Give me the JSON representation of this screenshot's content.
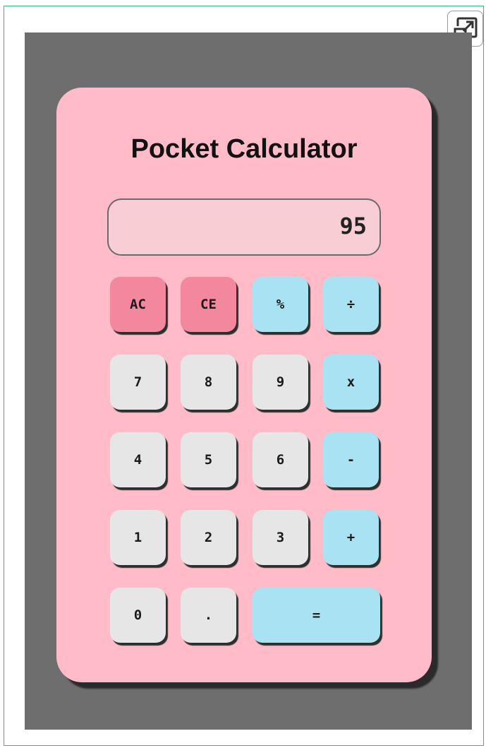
{
  "calculator": {
    "title": "Pocket Calculator",
    "display_value": "95",
    "rows": [
      [
        {
          "label": "AC",
          "kind": "red",
          "name": "all-clear-button"
        },
        {
          "label": "CE",
          "kind": "red",
          "name": "clear-entry-button"
        },
        {
          "label": "%",
          "kind": "blue",
          "name": "percent-button"
        },
        {
          "label": "÷",
          "kind": "blue",
          "name": "divide-button"
        }
      ],
      [
        {
          "label": "7",
          "kind": "gray",
          "name": "digit-7-button"
        },
        {
          "label": "8",
          "kind": "gray",
          "name": "digit-8-button"
        },
        {
          "label": "9",
          "kind": "gray",
          "name": "digit-9-button"
        },
        {
          "label": "x",
          "kind": "blue",
          "name": "multiply-button"
        }
      ],
      [
        {
          "label": "4",
          "kind": "gray",
          "name": "digit-4-button"
        },
        {
          "label": "5",
          "kind": "gray",
          "name": "digit-5-button"
        },
        {
          "label": "6",
          "kind": "gray",
          "name": "digit-6-button"
        },
        {
          "label": "-",
          "kind": "blue",
          "name": "subtract-button"
        }
      ],
      [
        {
          "label": "1",
          "kind": "gray",
          "name": "digit-1-button"
        },
        {
          "label": "2",
          "kind": "gray",
          "name": "digit-2-button"
        },
        {
          "label": "3",
          "kind": "gray",
          "name": "digit-3-button"
        },
        {
          "label": "+",
          "kind": "blue",
          "name": "add-button"
        }
      ],
      [
        {
          "label": "0",
          "kind": "gray",
          "name": "digit-0-button"
        },
        {
          "label": ".",
          "kind": "gray",
          "name": "decimal-point-button"
        },
        {
          "label": "=",
          "kind": "blue",
          "name": "equals-button"
        }
      ]
    ]
  },
  "toolbar": {
    "expand_icon": "expand-icon"
  },
  "colors": {
    "frame_border": "#2ebd78",
    "stage_background": "#6e6e6e",
    "calculator_body": "#ffbcc8",
    "display_background": "#f9cdd4",
    "clear_keys": "#f2879e",
    "operator_keys": "#a9e2f3",
    "digit_keys": "#e6e6e6"
  }
}
